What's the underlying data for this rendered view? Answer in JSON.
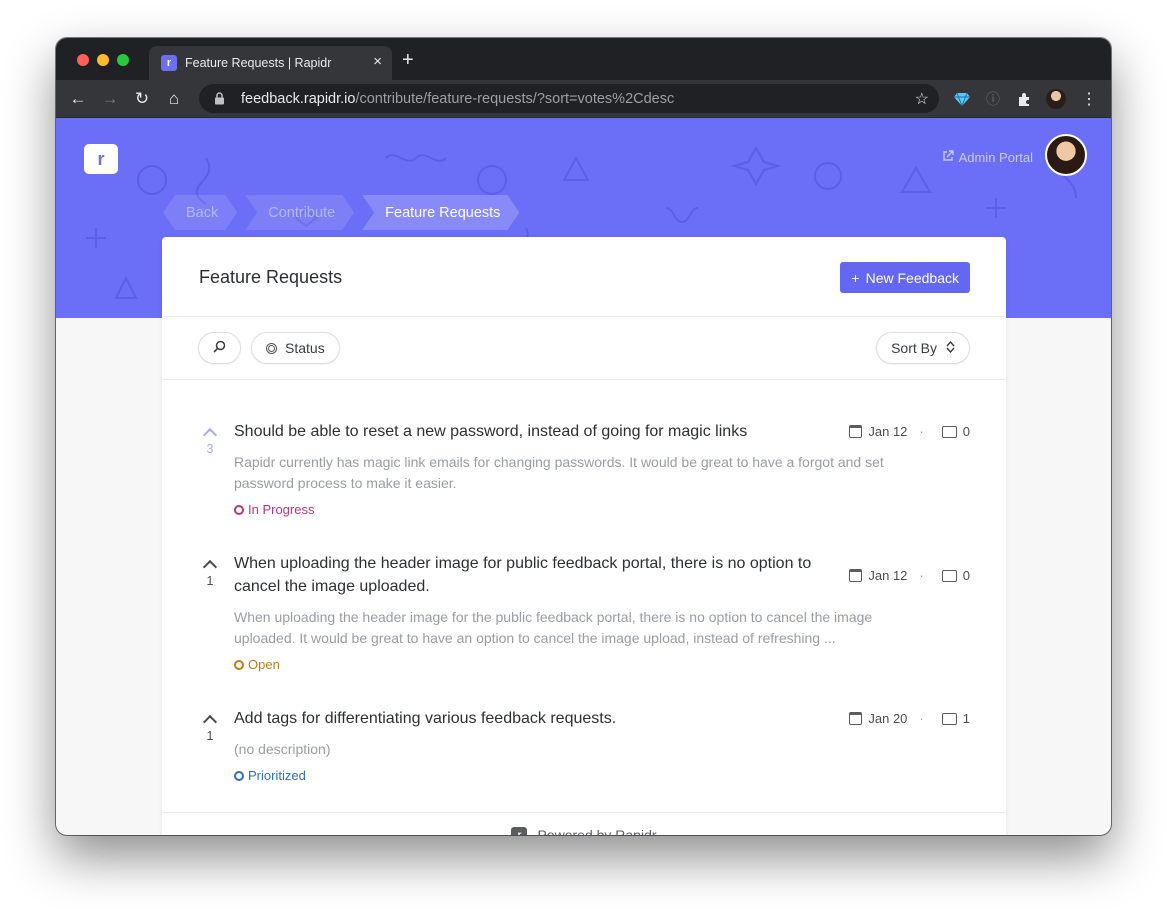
{
  "browser": {
    "tab_title": "Feature Requests | Rapidr",
    "tab_close": "×",
    "new_tab": "+",
    "url_host": "feedback.rapidr.io",
    "url_path": "/contribute/feature-requests/?sort=votes%2Cdesc"
  },
  "header": {
    "logo_letter": "r",
    "admin_portal_label": "Admin Portal"
  },
  "breadcrumb": [
    {
      "label": "Back"
    },
    {
      "label": "Contribute"
    },
    {
      "label": "Feature Requests"
    }
  ],
  "page": {
    "title": "Feature Requests",
    "new_feedback_label": "New Feedback"
  },
  "filters": {
    "status_label": "Status",
    "sort_label": "Sort By"
  },
  "colors": {
    "brand": "#6b6ef6",
    "in_progress": "#b8337a",
    "open": "#c07a17",
    "prioritized": "#2f6fb8"
  },
  "items": [
    {
      "votes": "3",
      "title": "Should be able to reset a new password, instead of going for magic links",
      "date": "Jan 12",
      "comments": "0",
      "description": "Rapidr currently has magic link emails for changing passwords. It would be great to have a forgot and set password process to make it easier.",
      "status": "In Progress"
    },
    {
      "votes": "1",
      "title": "When uploading the header image for public feedback portal, there is no option to cancel the image uploaded.",
      "date": "Jan 12",
      "comments": "0",
      "description": "When uploading the header image for the public feedback portal, there is no option to cancel the image uploaded. It would be great to have an option to cancel the image upload, instead of refreshing ...",
      "status": "Open"
    },
    {
      "votes": "1",
      "title": "Add tags for differentiating various feedback requests.",
      "date": "Jan 20",
      "comments": "1",
      "description": "(no description)",
      "status": "Prioritized"
    }
  ],
  "footer": {
    "powered_by": "Powered by Rapidr"
  }
}
